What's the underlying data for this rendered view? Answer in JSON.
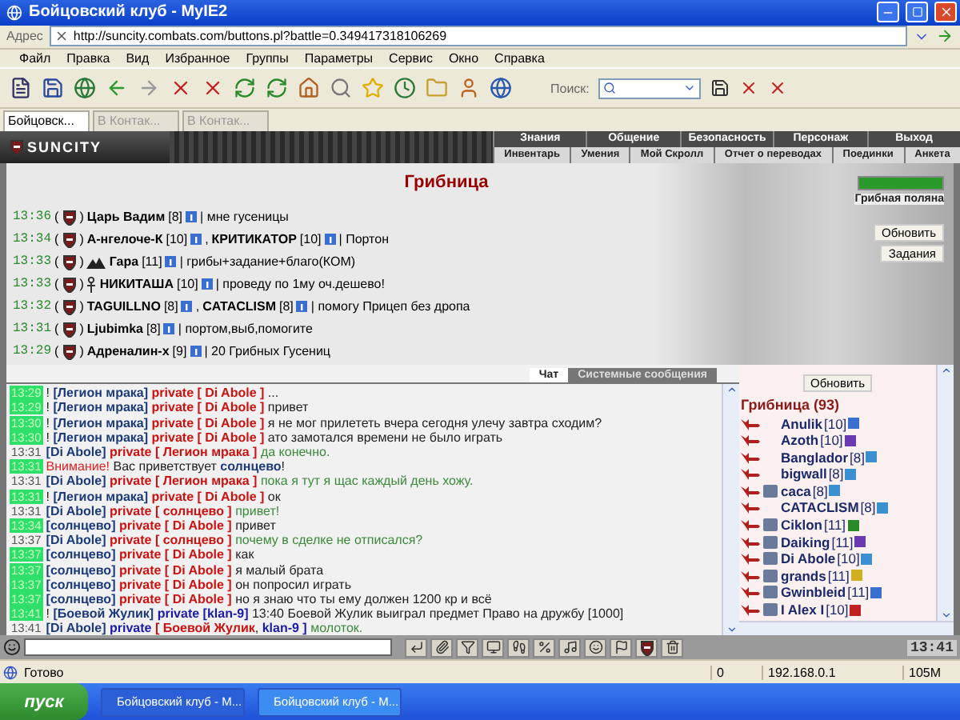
{
  "window": {
    "title": "Бойцовский клуб - MyIE2"
  },
  "address": {
    "label": "Адрес",
    "url": "http://suncity.combats.com/buttons.pl?battle=0.349417318106269"
  },
  "menu": [
    "Файл",
    "Правка",
    "Вид",
    "Избранное",
    "Группы",
    "Параметры",
    "Сервис",
    "Окно",
    "Справка"
  ],
  "toolbar": {
    "search_label": "Поиск:"
  },
  "tabs": [
    {
      "label": "Бойцовск...",
      "selected": true
    },
    {
      "label": "В Контак...",
      "selected": false
    },
    {
      "label": "В Контак...",
      "selected": false
    }
  ],
  "game": {
    "logo": "SUNCITY",
    "nav_top": [
      "Знания",
      "Общение",
      "Безопасность",
      "Персонаж",
      "Выход"
    ],
    "nav_bottom": [
      "Инвентарь",
      "Умения",
      "Мой Скролл",
      "Отчет о переводах",
      "Поединки",
      "Анкета"
    ]
  },
  "location": {
    "title": "Грибница",
    "place": "Грибная поляна",
    "hp": {
      "level": 1
    },
    "buttons": [
      "Обновить",
      "Задания"
    ],
    "posts": [
      {
        "time": "13:36",
        "marks": [
          "(",
          ")"
        ],
        "names": [
          {
            "name": "Царь Вадим",
            "rank": "[8]",
            "kind": "plain"
          }
        ],
        "message": "| мне гусеницы"
      },
      {
        "time": "13:34",
        "marks": [
          "(",
          ")"
        ],
        "names": [
          {
            "name": "А-нгелоче-К",
            "rank": "[10]",
            "kind": "plain",
            "suffix": ","
          },
          {
            "name": "КРИТИКАТОР",
            "rank": "[10]",
            "kind": "plain"
          }
        ],
        "message": "| Портон"
      },
      {
        "time": "13:33",
        "marks": [
          "(",
          ")"
        ],
        "names": [
          {
            "name": "Гара",
            "rank": "[11]",
            "kind": "mountain"
          }
        ],
        "message": "| грибы+задание+благо(КОМ)"
      },
      {
        "time": "13:33",
        "marks": [
          "(",
          ")"
        ],
        "names": [
          {
            "name": "НИКИТАША",
            "rank": "[10]",
            "kind": "ankh"
          }
        ],
        "message": "| проведу по 1му оч.дешево!"
      },
      {
        "time": "13:32",
        "marks": [
          "(",
          ")"
        ],
        "names": [
          {
            "name": "TAGUILLNO",
            "rank": "[8]",
            "kind": "plain",
            "suffix": ","
          },
          {
            "name": "CATACLISM",
            "rank": "[8]",
            "kind": "plain"
          }
        ],
        "message": "| помогу Прицеп без дропа"
      },
      {
        "time": "13:31",
        "marks": [
          "(",
          ")"
        ],
        "names": [
          {
            "name": "Ljubimka",
            "rank": "[8]",
            "kind": "plain"
          }
        ],
        "message": "| портом,выб,помогите"
      },
      {
        "time": "13:29",
        "marks": [
          "(",
          ")"
        ],
        "names": [
          {
            "name": "Адреналин-х",
            "rank": "[9]",
            "kind": "plain"
          }
        ],
        "message": "| 20 Грибных Гусениц"
      }
    ]
  },
  "chat": {
    "tabs": [
      {
        "label": "Чат",
        "selected": true
      },
      {
        "label": "Системные сообщения",
        "selected": false
      }
    ],
    "lines": [
      {
        "time": "13:29",
        "highlighted": true,
        "segments": [
          {
            "kind": "mark",
            "text": "!"
          },
          {
            "kind": "sender",
            "text": "[Легион мрака]"
          },
          {
            "kind": "target",
            "text": "private [ Di Abole ]"
          },
          {
            "kind": "text",
            "text": "..."
          }
        ]
      },
      {
        "time": "13:29",
        "highlighted": true,
        "segments": [
          {
            "kind": "mark",
            "text": "!"
          },
          {
            "kind": "sender",
            "text": "[Легион мрака]"
          },
          {
            "kind": "target",
            "text": "private [ Di Abole ]"
          },
          {
            "kind": "text",
            "text": "привет"
          }
        ]
      },
      {
        "time": "13:30",
        "highlighted": true,
        "segments": [
          {
            "kind": "mark",
            "text": "!"
          },
          {
            "kind": "sender",
            "text": "[Легион мрака]"
          },
          {
            "kind": "target",
            "text": "private [ Di Abole ]"
          },
          {
            "kind": "text",
            "text": "я не мог прилететь вчера сегодня улечу завтра сходим?"
          }
        ]
      },
      {
        "time": "13:30",
        "highlighted": true,
        "segments": [
          {
            "kind": "mark",
            "text": "!"
          },
          {
            "kind": "sender",
            "text": "[Легион мрака]"
          },
          {
            "kind": "target",
            "text": "private [ Di Abole ]"
          },
          {
            "kind": "text",
            "text": "ато замотался времени не было играть"
          }
        ]
      },
      {
        "time": "13:31",
        "highlighted": false,
        "segments": [
          {
            "kind": "sender",
            "text": "[Di Abole]"
          },
          {
            "kind": "target",
            "text": "private [ Легион мрака ]"
          },
          {
            "kind": "reply",
            "text": "да конечно."
          }
        ]
      },
      {
        "time": "13:31",
        "highlighted": true,
        "segments": [
          {
            "kind": "warning",
            "text": "Внимание!"
          },
          {
            "kind": "text",
            "text": "Вас приветствует"
          },
          {
            "kind": "nick",
            "text": "солнцево"
          },
          {
            "kind": "close",
            "text": "!"
          }
        ]
      },
      {
        "time": "13:31",
        "highlighted": false,
        "segments": [
          {
            "kind": "sender",
            "text": "[Di Abole]"
          },
          {
            "kind": "target",
            "text": "private [ Легион мрака ]"
          },
          {
            "kind": "reply",
            "text": "пока я тут я щас каждый день хожу."
          }
        ]
      },
      {
        "time": "13:31",
        "highlighted": true,
        "segments": [
          {
            "kind": "mark",
            "text": "!"
          },
          {
            "kind": "sender",
            "text": "[Легион мрака]"
          },
          {
            "kind": "target",
            "text": "private [ Di Abole ]"
          },
          {
            "kind": "text",
            "text": "ок"
          }
        ]
      },
      {
        "time": "13:31",
        "highlighted": false,
        "segments": [
          {
            "kind": "sender",
            "text": "[Di Abole]"
          },
          {
            "kind": "target",
            "text": "private [ солнцево ]"
          },
          {
            "kind": "reply",
            "text": "привет!"
          }
        ]
      },
      {
        "time": "13:34",
        "highlighted": true,
        "segments": [
          {
            "kind": "sender",
            "text": "[солнцево]"
          },
          {
            "kind": "target",
            "text": "private [ Di Abole ]"
          },
          {
            "kind": "text",
            "text": "привет"
          }
        ]
      },
      {
        "time": "13:37",
        "highlighted": false,
        "segments": [
          {
            "kind": "sender",
            "text": "[Di Abole]"
          },
          {
            "kind": "target",
            "text": "private [ солнцево ]"
          },
          {
            "kind": "reply",
            "text": "почему в сделке не отписался?"
          }
        ]
      },
      {
        "time": "13:37",
        "highlighted": true,
        "segments": [
          {
            "kind": "sender",
            "text": "[солнцево]"
          },
          {
            "kind": "target",
            "text": "private [ Di Abole ]"
          },
          {
            "kind": "text",
            "text": "как"
          }
        ]
      },
      {
        "time": "13:37",
        "highlighted": true,
        "segments": [
          {
            "kind": "sender",
            "text": "[солнцево]"
          },
          {
            "kind": "target",
            "text": "private [ Di Abole ]"
          },
          {
            "kind": "text",
            "text": "я малый брата"
          }
        ]
      },
      {
        "time": "13:37",
        "highlighted": true,
        "segments": [
          {
            "kind": "sender",
            "text": "[солнцево]"
          },
          {
            "kind": "target",
            "text": "private [ Di Abole ]"
          },
          {
            "kind": "text",
            "text": "он попросил играть"
          }
        ]
      },
      {
        "time": "13:37",
        "highlighted": true,
        "segments": [
          {
            "kind": "sender",
            "text": "[солнцево]"
          },
          {
            "kind": "target",
            "text": "private [ Di Abole ]"
          },
          {
            "kind": "text",
            "text": "но я знаю что ты ему должен 1200 кр и всё"
          }
        ]
      },
      {
        "time": "13:41",
        "highlighted": true,
        "segments": [
          {
            "kind": "mark",
            "text": "!"
          },
          {
            "kind": "sender",
            "text": "[Боевой Жулик]"
          },
          {
            "kind": "group",
            "text": "private [klan-9]"
          },
          {
            "kind": "text",
            "text": "13:40 Боевой Жулик выиграл предмет Право на дружбу [1000]"
          }
        ]
      },
      {
        "time": "13:41",
        "highlighted": false,
        "segments": [
          {
            "kind": "sender",
            "text": "[Di Abole]"
          },
          {
            "kind": "group",
            "text": "private"
          },
          {
            "kind": "target",
            "text": "[ Боевой Жулик"
          },
          {
            "kind": "close",
            "text": ","
          },
          {
            "kind": "group",
            "text": "klan-9 ]"
          },
          {
            "kind": "reply",
            "text": "молоток."
          }
        ]
      }
    ]
  },
  "online": {
    "refresh": "Обновить",
    "title": "Грибница (93)",
    "users": [
      {
        "name": "Anulik",
        "rank": "[10]",
        "kind": "plain",
        "color": "#3a6fd0"
      },
      {
        "name": "Azoth",
        "rank": "[10]",
        "kind": "plain",
        "color": "#6a3ab0"
      },
      {
        "name": "Banglador",
        "rank": "[8]",
        "kind": "plain",
        "color": "#3a8fd0"
      },
      {
        "name": "bigwall",
        "rank": "[8]",
        "kind": "plain",
        "color": "#3a8fd0"
      },
      {
        "name": "caca",
        "rank": "[8]",
        "kind": "emblem",
        "color": "#3a8fd0"
      },
      {
        "name": "CATACLISM",
        "rank": "[8]",
        "kind": "plain",
        "color": "#3a8fd0"
      },
      {
        "name": "Ciklon",
        "rank": "[11]",
        "kind": "emblem",
        "color": "#2a8a2a"
      },
      {
        "name": "Daiking",
        "rank": "[11]",
        "kind": "emblem",
        "color": "#6a3ab0"
      },
      {
        "name": "Di Abole",
        "rank": "[10]",
        "kind": "emblem",
        "color": "#3a8fd0"
      },
      {
        "name": "grands",
        "rank": "[11]",
        "kind": "emblem",
        "color": "#d0b020"
      },
      {
        "name": "Gwinbleid",
        "rank": "[11]",
        "kind": "emblem",
        "color": "#3a6fd0"
      },
      {
        "name": "I Alex I",
        "rank": "[10]",
        "kind": "emblem",
        "color": "#c02020"
      }
    ]
  },
  "clock": "13:41",
  "status_bar": {
    "text": "Готово",
    "count": "0",
    "ip": "192.168.0.1",
    "memory": "105M"
  },
  "taskbar": {
    "start": "пуск",
    "tasks": [
      {
        "label": "Бойцовский клуб - М...",
        "selected": false
      },
      {
        "label": "Бойцовский клуб - М...",
        "selected": true
      }
    ]
  }
}
